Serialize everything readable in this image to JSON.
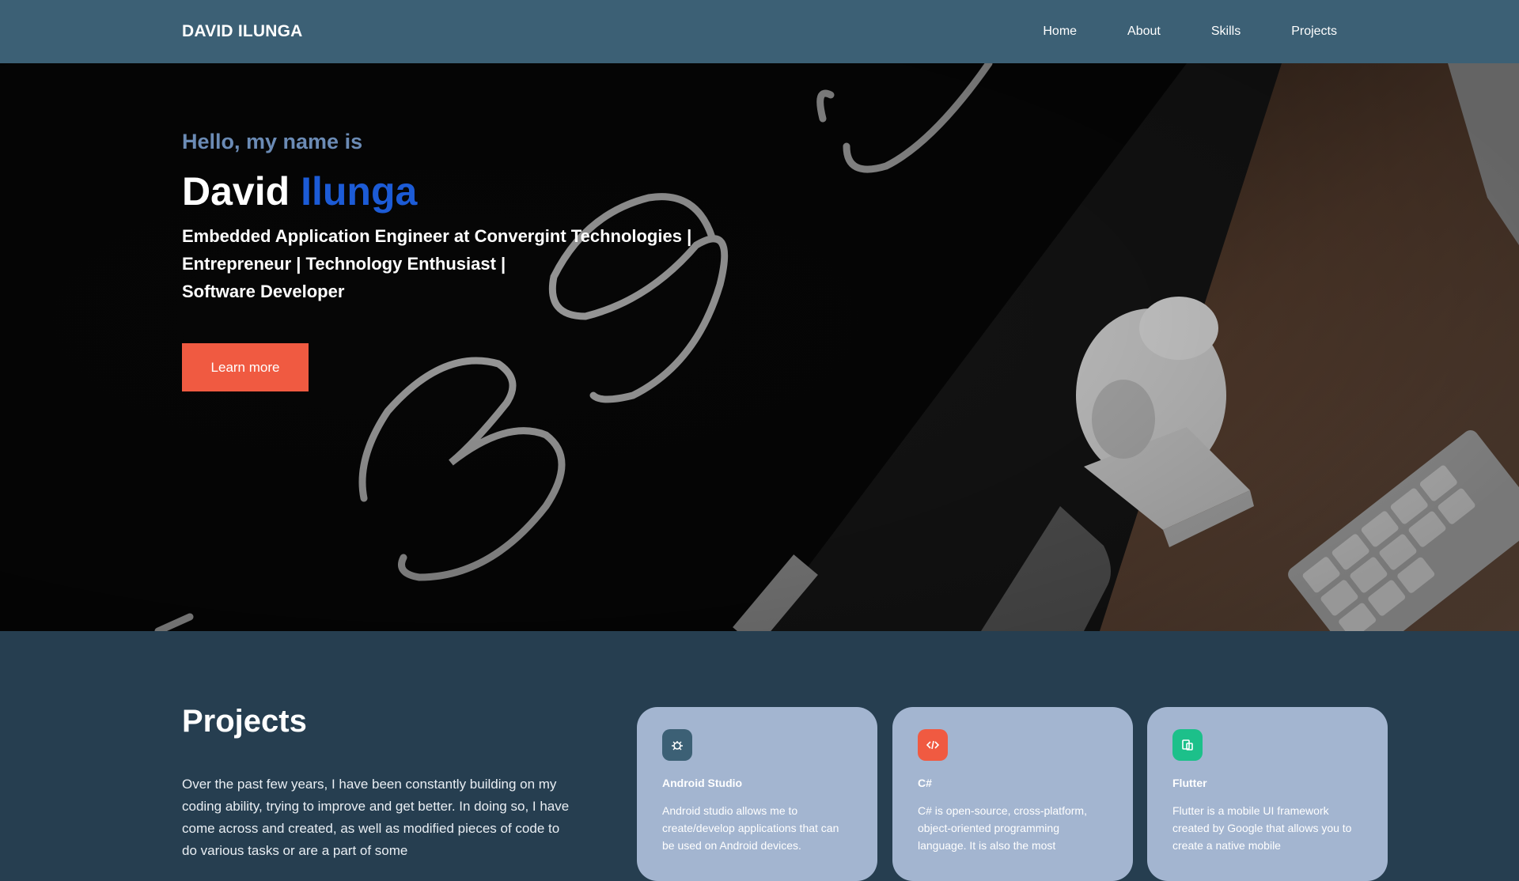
{
  "nav": {
    "brand": "DAVID ILUNGA",
    "links": [
      {
        "label": "Home"
      },
      {
        "label": "About"
      },
      {
        "label": "Skills"
      },
      {
        "label": "Projects"
      }
    ]
  },
  "hero": {
    "greeting": "Hello, my name is",
    "first_name": "David",
    "last_name": "Ilunga",
    "tagline_lines": [
      "Embedded Application Engineer at Convergint Technologies |",
      "Entrepreneur | Technology Enthusiast |",
      "Software Developer"
    ],
    "cta_label": "Learn more",
    "colors": {
      "greeting": "#6b8bb5",
      "accent": "#1c5bd6",
      "button": "#f05a41"
    }
  },
  "projects": {
    "title": "Projects",
    "intro": "Over the past few years, I have been constantly building on my coding ability, trying to improve and get better. In doing so, I have come across and created, as well as modified pieces of code to do various tasks or are a part of some",
    "cards": [
      {
        "icon": "bug-icon",
        "icon_color": "#3c6075",
        "title": "Android Studio",
        "text": "Android studio allows me to create/develop applications that can be used on Android devices."
      },
      {
        "icon": "code-icon",
        "icon_color": "#f05a41",
        "title": "C#",
        "text": "C# is open-source, cross-platform, object-oriented programming language. It is also the most"
      },
      {
        "icon": "device-icon",
        "icon_color": "#1cc08a",
        "title": "Flutter",
        "text": "Flutter is a mobile UI framework created by Google that allows you to create a native mobile"
      }
    ]
  }
}
